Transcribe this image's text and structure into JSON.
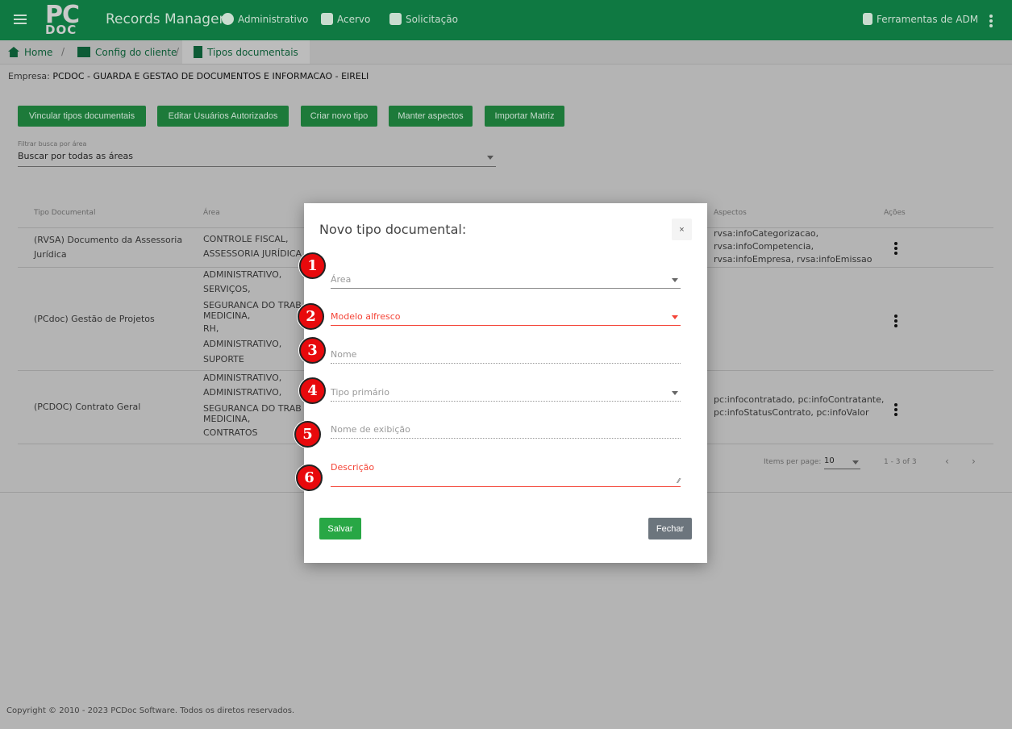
{
  "header": {
    "app_title": "Records Manager",
    "logo_top": "PC",
    "logo_bottom": "DOC",
    "nav": [
      "Administrativo",
      "Acervo",
      "Solicitação"
    ],
    "admin_tools": "Ferramentas de ADM"
  },
  "breadcrumb": [
    "Home",
    "Config do cliente",
    "Tipos documentais"
  ],
  "empresa": {
    "label": "Empresa:",
    "value": "PCDOC - GUARDA E GESTAO DE DOCUMENTOS E INFORMACAO - EIRELI"
  },
  "toolbar": [
    "Vincular tipos documentais",
    "Editar Usuários Autorizados",
    "Criar novo tipo",
    "Manter aspectos",
    "Importar Matriz"
  ],
  "filter": {
    "label": "Filtrar busca por área",
    "value": "Buscar por todas as áreas"
  },
  "table": {
    "headers": {
      "tipo": "Tipo Documental",
      "area": "Área",
      "aspectos": "Aspectos",
      "acoes": "Ações"
    },
    "rows": [
      {
        "tipo": "(RVSA) Documento da Assessoria Jurídica",
        "areas": [
          "CONTROLE FISCAL,",
          "ASSESSORIA JURÍDICA"
        ],
        "aspectos": "rvsa:infoCategorizacao, rvsa:infoCompetencia, rvsa:infoEmpresa, rvsa:infoEmissao"
      },
      {
        "tipo": "(PCdoc) Gestão de Projetos",
        "areas": [
          "ADMINISTRATIVO,",
          "SERVIÇOS,",
          "SEGURANCA DO TRAB",
          "MEDICINA,",
          "RH,",
          "ADMINISTRATIVO,",
          "SUPORTE"
        ],
        "aspectos": ""
      },
      {
        "tipo": "(PCDOC) Contrato Geral",
        "areas": [
          "ADMINISTRATIVO,",
          "ADMINISTRATIVO,",
          "SEGURANCA DO TRAB",
          "MEDICINA,",
          "CONTRATOS"
        ],
        "aspectos": "pc:infocontratado, pc:infoContratante, pc:infoStatusContrato, pc:infoValor"
      }
    ]
  },
  "pagination": {
    "items_label": "Items per page:",
    "items_value": "10",
    "range": "1 - 3 of 3"
  },
  "footer": "Copyright © 2010 - 2023 PCDoc Software. Todos os diretos reservados.",
  "modal": {
    "title": "Novo tipo documental:",
    "close": "×",
    "fields": [
      "Área",
      "Modelo alfresco",
      "Nome",
      "Tipo primário",
      "Nome de exibição",
      "Descrição"
    ],
    "badges": [
      "1",
      "2",
      "3",
      "4",
      "5",
      "6"
    ],
    "save": "Salvar",
    "close_button": "Fechar"
  },
  "colors": {
    "header": "#0f7942",
    "button": "#1d7a3a",
    "error": "#f44336",
    "badge": "#e8090c",
    "save": "#28a745",
    "close": "#6c757d"
  }
}
